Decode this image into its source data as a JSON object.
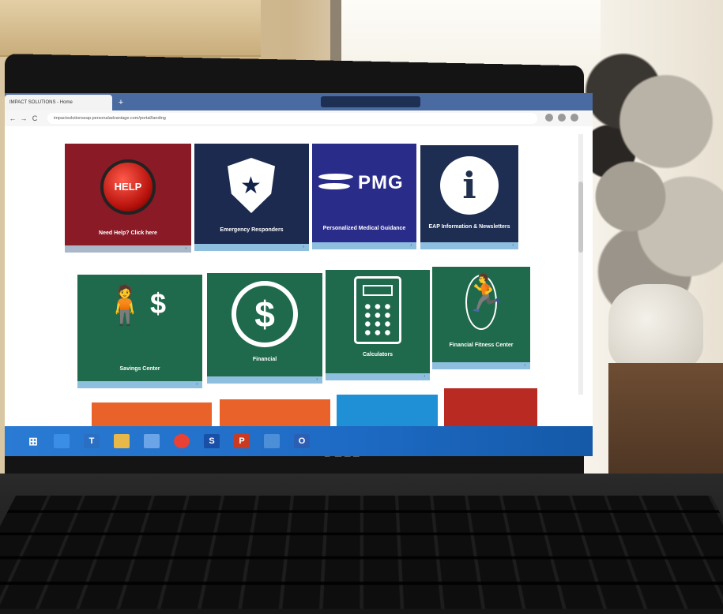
{
  "browser": {
    "tab_title": "IMPACT SOLUTIONS - Home",
    "new_tab_symbol": "+",
    "url": "impactsolutionseap.personaladvantage.com/portal/landing",
    "back_symbol": "←",
    "forward_symbol": "→",
    "reload_symbol": "C"
  },
  "tiles_row1": [
    {
      "label": "Need Help? Click here",
      "badge": "HELP",
      "color": "#8a1a26"
    },
    {
      "label": "Emergency Responders",
      "color": "#1b2a4e"
    },
    {
      "label": "Personalized Medical Guidance",
      "logo": "PMG",
      "color": "#2a2c8a"
    },
    {
      "label": "EAP Information & Newsletters",
      "icon_letter": "i",
      "color": "#1e2d52"
    }
  ],
  "tiles_row2": [
    {
      "label": "Savings Center",
      "symbol": "$",
      "color": "#1f6a4c"
    },
    {
      "label": "Financial",
      "symbol": "$",
      "color": "#1f6a4c"
    },
    {
      "label": "Calculators",
      "color": "#1f6a4c"
    },
    {
      "label": "Financial Fitness Center",
      "color": "#1f6a4c"
    }
  ],
  "tiles_row3_colors": [
    "#e8622a",
    "#e8622a",
    "#1f8fd6",
    "#b82a22"
  ],
  "tile_foot_color": "#8fbfdf",
  "laptop_brand": "DELL",
  "icons": [
    "help-button-icon",
    "police-badge-icon",
    "pmg-logo-icon",
    "info-icon",
    "person-dollar-icon",
    "dollar-circle-icon",
    "calculator-icon",
    "jump-rope-icon",
    "windows-start-icon"
  ],
  "taskbar_colors": [
    "#1d6ac4"
  ]
}
